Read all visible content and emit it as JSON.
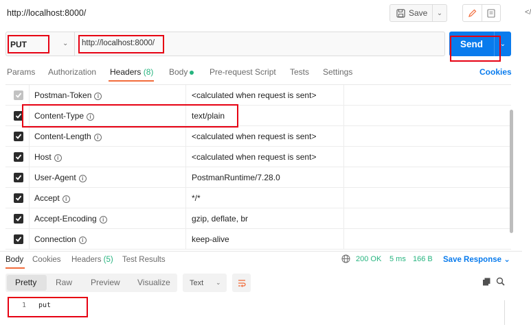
{
  "title": "http://localhost:8000/",
  "toolbar": {
    "save_label": "Save"
  },
  "request": {
    "method": "PUT",
    "url": "http://localhost:8000/",
    "send_label": "Send"
  },
  "request_tabs": [
    {
      "label": "Params"
    },
    {
      "label": "Authorization"
    },
    {
      "label": "Headers",
      "count": "(8)"
    },
    {
      "label": "Body"
    },
    {
      "label": "Pre-request Script"
    },
    {
      "label": "Tests"
    },
    {
      "label": "Settings"
    }
  ],
  "cookies_label": "Cookies",
  "headers": [
    {
      "key": "Postman-Token",
      "value": "<calculated when request is sent>"
    },
    {
      "key": "Content-Type",
      "value": "text/plain"
    },
    {
      "key": "Content-Length",
      "value": "<calculated when request is sent>"
    },
    {
      "key": "Host",
      "value": "<calculated when request is sent>"
    },
    {
      "key": "User-Agent",
      "value": "PostmanRuntime/7.28.0"
    },
    {
      "key": "Accept",
      "value": "*/*"
    },
    {
      "key": "Accept-Encoding",
      "value": "gzip, deflate, br"
    },
    {
      "key": "Connection",
      "value": "keep-alive"
    }
  ],
  "info_glyph": "i",
  "response": {
    "tabs": [
      {
        "label": "Body"
      },
      {
        "label": "Cookies"
      },
      {
        "label": "Headers",
        "count": "(5)"
      },
      {
        "label": "Test Results"
      }
    ],
    "status": "200 OK",
    "time": "5 ms",
    "size": "166 B",
    "save_label": "Save Response",
    "views": [
      "Pretty",
      "Raw",
      "Preview",
      "Visualize"
    ],
    "format": "Text",
    "lines": [
      {
        "no": "1",
        "text": "put"
      }
    ]
  },
  "colors": {
    "accent_orange": "#f26b3a",
    "send_blue": "#097bed",
    "success_green": "#26b47f",
    "annotation_red": "#e60012"
  }
}
